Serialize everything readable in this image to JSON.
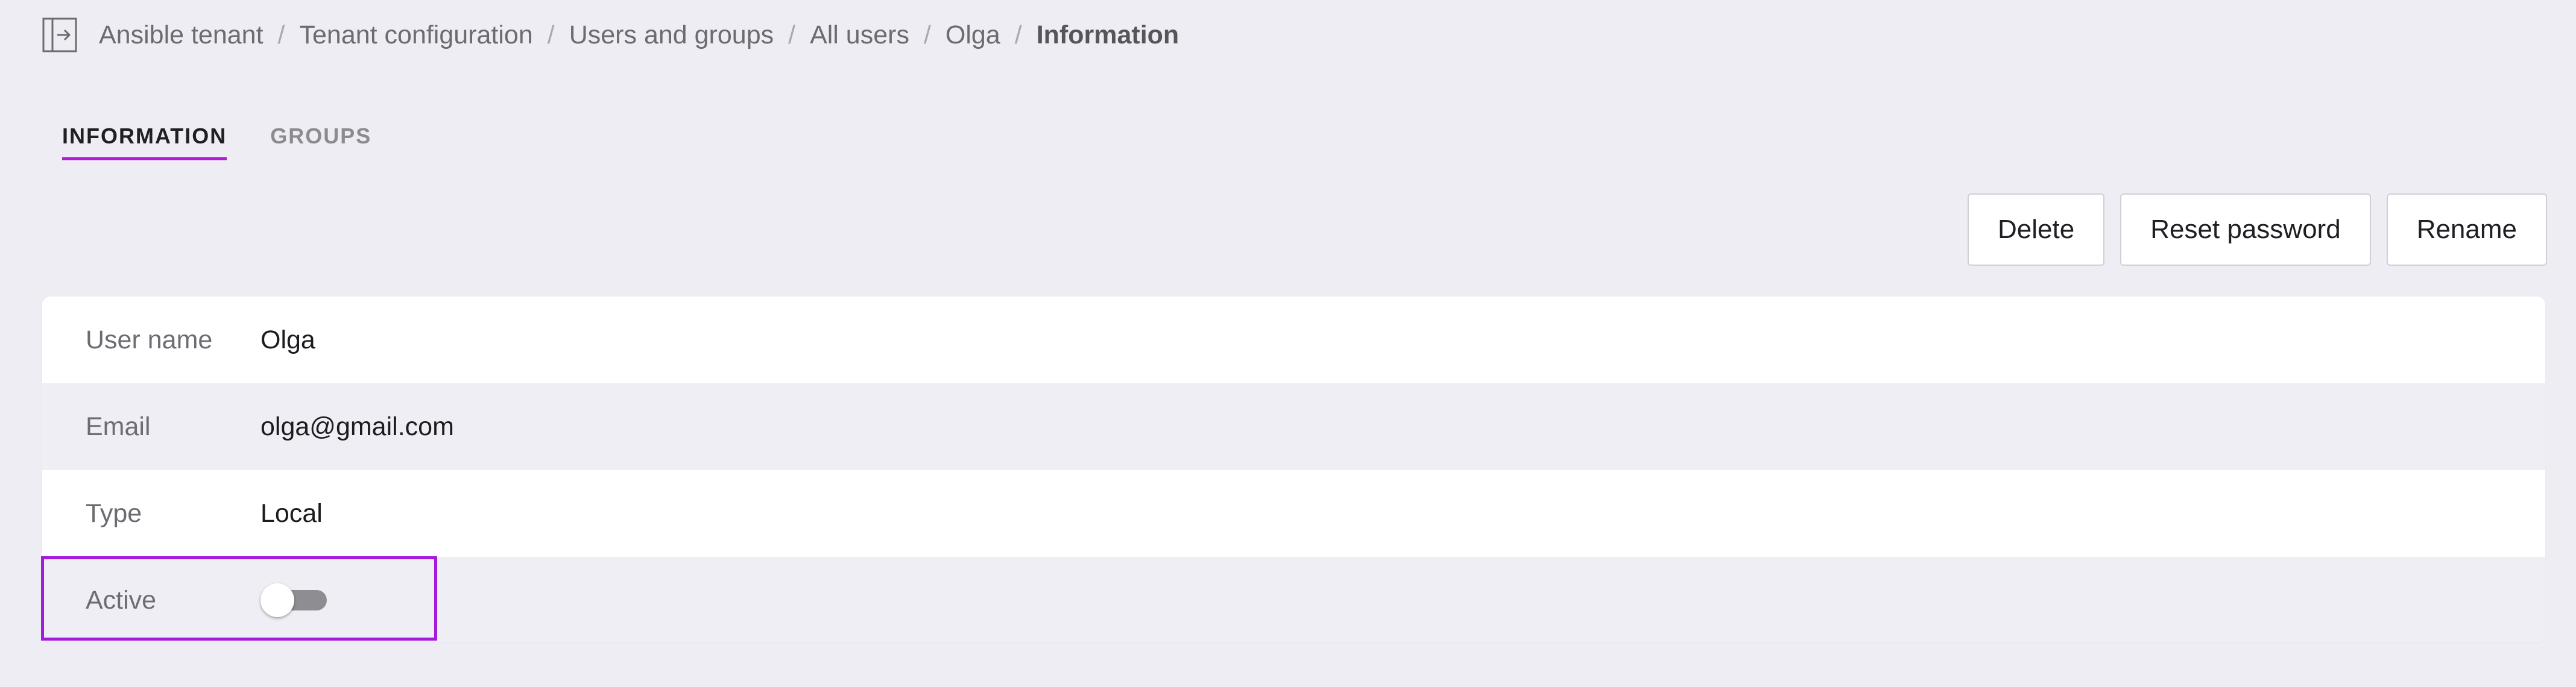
{
  "header": {
    "sidebar_toggle_icon": "sidebar-toggle-icon",
    "breadcrumb": [
      {
        "label": "Ansible tenant"
      },
      {
        "label": "Tenant configuration"
      },
      {
        "label": "Users and groups"
      },
      {
        "label": "All users"
      },
      {
        "label": "Olga"
      },
      {
        "label": "Information"
      }
    ],
    "separator": "/"
  },
  "tabs": [
    {
      "label": "INFORMATION",
      "active": true
    },
    {
      "label": "GROUPS",
      "active": false
    }
  ],
  "actions": {
    "delete_label": "Delete",
    "reset_password_label": "Reset password",
    "rename_label": "Rename"
  },
  "info": {
    "user_name": {
      "label": "User name",
      "value": "Olga"
    },
    "email": {
      "label": "Email",
      "value": "olga@gmail.com"
    },
    "type": {
      "label": "Type",
      "value": "Local"
    },
    "active": {
      "label": "Active",
      "checked": false
    }
  },
  "colors": {
    "accent": "#b41bd6",
    "highlight": "#a41bdd",
    "background": "#eeedf3"
  }
}
